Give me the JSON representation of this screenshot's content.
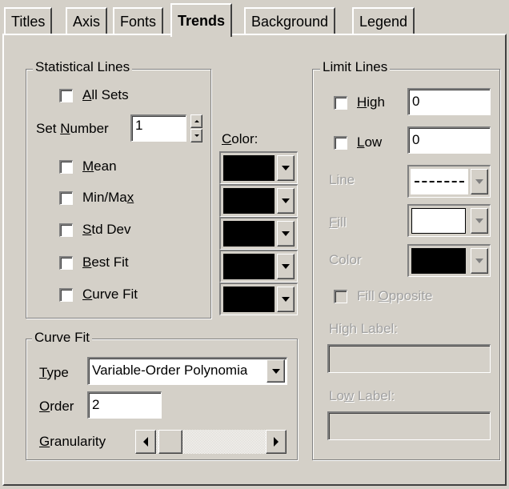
{
  "tabs": [
    {
      "label": "Titles"
    },
    {
      "label": "Axis"
    },
    {
      "label": "Fonts"
    },
    {
      "label": "Trends",
      "active": true
    },
    {
      "label": "Background"
    },
    {
      "label": "Legend"
    }
  ],
  "statistical_lines": {
    "title": "Statistical Lines",
    "all_sets": {
      "pre": "",
      "key": "A",
      "post": "ll Sets",
      "checked": false
    },
    "set_number": {
      "pre": "Set ",
      "key": "N",
      "post": "umber",
      "value": "1"
    },
    "color_label": {
      "key": "C",
      "post": "olor:"
    },
    "items": [
      {
        "pre": "",
        "key": "M",
        "post": "ean",
        "checked": false,
        "color": "#000000"
      },
      {
        "pre": "Min/Ma",
        "key": "x",
        "post": "",
        "checked": false,
        "color": "#000000"
      },
      {
        "pre": "",
        "key": "S",
        "post": "td Dev",
        "checked": false,
        "color": "#000000"
      },
      {
        "pre": "",
        "key": "B",
        "post": "est Fit",
        "checked": false,
        "color": "#000000"
      },
      {
        "pre": "",
        "key": "C",
        "post": "urve Fit",
        "checked": false,
        "color": "#000000"
      }
    ]
  },
  "curve_fit": {
    "title": "Curve Fit",
    "type": {
      "key": "T",
      "post": "ype",
      "value": "Variable-Order Polynomia"
    },
    "order": {
      "key": "O",
      "post": "rder",
      "value": "2"
    },
    "granularity": {
      "key": "G",
      "post": "ranularity",
      "position": 0.0
    }
  },
  "limit_lines": {
    "title": "Limit Lines",
    "high": {
      "key": "H",
      "post": "igh",
      "checked": false,
      "value": "0"
    },
    "low": {
      "key": "L",
      "post": "ow",
      "checked": false,
      "value": "0"
    },
    "line": {
      "label": "Line",
      "style": "dashed"
    },
    "fill": {
      "key": "F",
      "post": "ill",
      "color": "#ffffff"
    },
    "color": {
      "label": "Color",
      "color": "#000000"
    },
    "fill_opposite": {
      "pre": "Fill ",
      "key": "O",
      "post": "pposite",
      "checked": false
    },
    "high_label": {
      "pre": "Hi",
      "key": "g",
      "post": "h Label:",
      "value": ""
    },
    "low_label": {
      "pre": "Lo",
      "key": "w",
      "post": " Label:",
      "value": ""
    }
  }
}
